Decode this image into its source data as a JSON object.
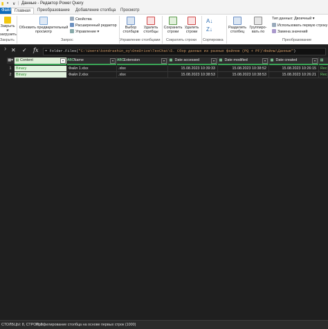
{
  "titlebar": {
    "title": "Данные - Редактор Power Query",
    "icons": [
      "app-icon",
      "save-icon",
      "undo-icon"
    ]
  },
  "tabs": [
    {
      "label": "Файл"
    },
    {
      "label": "Главная"
    },
    {
      "label": "Преобразование"
    },
    {
      "label": "Добавление столбца"
    },
    {
      "label": "Просмотр"
    }
  ],
  "ribbon": {
    "close": {
      "btn1_line1": "Закрыть и",
      "btn1_line2": "загрузить",
      "group": "Закрыть"
    },
    "query": {
      "refresh_line1": "Обновить предварительный",
      "refresh_line2": "просмотр",
      "properties": "Свойства",
      "advanced": "Расширенный редактор",
      "manage": "Управление",
      "group": "Запрос"
    },
    "columns": {
      "choose_line1": "Выбор",
      "choose_line2": "столбцов",
      "remove_line1": "Удалить",
      "remove_line2": "столбцы",
      "group": "Управление столбцами"
    },
    "rows": {
      "keep_line1": "Сохранить",
      "keep_line2": "строки",
      "remove_line1": "Удалить",
      "remove_line2": "строки",
      "group": "Сократить строки"
    },
    "sort": {
      "group": "Сортировка"
    },
    "transform": {
      "split_line1": "Разделить",
      "split_line2": "столбец",
      "groupby_line1": "Группиро-",
      "groupby_line2": "вать по",
      "datatype": "Тип данных: Двоичный",
      "firstrow": "Использовать первую строку",
      "replace": "Замена значений",
      "group": "Преобразование"
    }
  },
  "formula": {
    "fx": "fx",
    "prefix": "= Folder.Files(",
    "path": "\"C:\\Users\\kondrashin_oy\\OneDrive\\TexChat\\5. Сбор данных из разных файлов (PQ + PF)\\Файлы\\Данные\"",
    "suffix": ")"
  },
  "columns": [
    {
      "name": "Content",
      "type": "▤",
      "selected": true
    },
    {
      "name": "Name",
      "type": "ABC"
    },
    {
      "name": "Extension",
      "type": "ABC"
    },
    {
      "name": "Date accessed",
      "type": "▦"
    },
    {
      "name": "Date modified",
      "type": "▦"
    },
    {
      "name": "Date created",
      "type": "▦"
    }
  ],
  "rows": [
    {
      "num": "1",
      "content": "Binary",
      "name": "Файл 1.xlsx",
      "ext": ".xlsx",
      "accessed": "15.08.2023 10:39:33",
      "modified": "15.08.2023 10:38:52",
      "created": "15.08.2023 10:26:15",
      "extra": "Recor"
    },
    {
      "num": "2",
      "content": "Binary",
      "name": "Файл 2.xlsx",
      "ext": ".xlsx",
      "accessed": "15.08.2023 10:38:53",
      "modified": "15.08.2023 10:38:53",
      "created": "15.08.2023 10:26:21",
      "extra": "Recor"
    }
  ],
  "status": {
    "left": "СТОЛБЦЫ: 8, СТРОК: 2",
    "profile": "Профилирование столбца на основе первых строк (1000)"
  }
}
